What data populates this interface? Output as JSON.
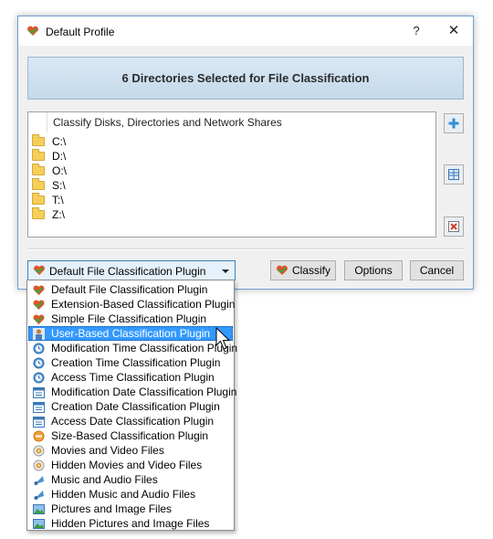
{
  "window": {
    "title": "Default Profile",
    "help_label": "?",
    "close_label": "✕"
  },
  "banner": {
    "text": "6 Directories Selected for File Classification"
  },
  "directories": {
    "header": "Classify Disks, Directories and Network Shares",
    "items": [
      "C:\\",
      "D:\\",
      "O:\\",
      "S:\\",
      "T:\\",
      "Z:\\"
    ]
  },
  "side_buttons": [
    {
      "icon": "plus-icon"
    },
    {
      "icon": "columns-icon"
    },
    {
      "icon": "delete-icon"
    }
  ],
  "plugin_combo": {
    "selected": "Default File Classification Plugin",
    "icon": "plugin-icon"
  },
  "buttons": {
    "classify": "Classify",
    "options": "Options",
    "cancel": "Cancel"
  },
  "dropdown": {
    "selected_index": 3,
    "items": [
      {
        "label": "Default File Classification Plugin",
        "icon": "plugin-icon"
      },
      {
        "label": "Extension-Based Classification Plugin",
        "icon": "plugin-icon"
      },
      {
        "label": "Simple File Classification Plugin",
        "icon": "plugin-icon"
      },
      {
        "label": "User-Based Classification Plugin",
        "icon": "user-icon"
      },
      {
        "label": "Modification Time Classification Plugin",
        "icon": "clock-icon"
      },
      {
        "label": "Creation Time Classification Plugin",
        "icon": "clock-icon"
      },
      {
        "label": "Access Time Classification Plugin",
        "icon": "clock-icon"
      },
      {
        "label": "Modification Date Classification Plugin",
        "icon": "calendar-icon"
      },
      {
        "label": "Creation Date Classification Plugin",
        "icon": "calendar-icon"
      },
      {
        "label": "Access Date Classification Plugin",
        "icon": "calendar-icon"
      },
      {
        "label": "Size-Based Classification Plugin",
        "icon": "size-icon"
      },
      {
        "label": "Movies and Video Files",
        "icon": "video-icon"
      },
      {
        "label": "Hidden Movies and Video Files",
        "icon": "video-icon"
      },
      {
        "label": "Music and Audio Files",
        "icon": "music-icon"
      },
      {
        "label": "Hidden Music and Audio Files",
        "icon": "music-icon"
      },
      {
        "label": "Pictures and Image Files",
        "icon": "picture-icon"
      },
      {
        "label": "Hidden Pictures and Image Files",
        "icon": "picture-icon"
      }
    ]
  },
  "colors": {
    "accent": "#3399ff",
    "window_border": "#6c9fd6",
    "banner": "#c9dcec"
  }
}
